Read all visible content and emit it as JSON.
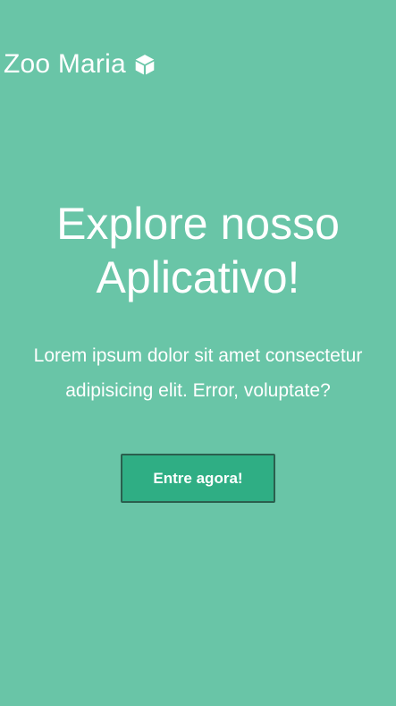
{
  "brand": {
    "name": "Zoo Maria",
    "icon": "cube-icon"
  },
  "hero": {
    "title": "Explore nosso Aplicativo!",
    "text": "Lorem ipsum dolor sit amet consectetur adipisicing elit. Error, voluptate?"
  },
  "cta": {
    "label": "Entre agora!"
  },
  "colors": {
    "background": "#69c5a7",
    "button": "#2fae84",
    "button_border": "#2b5f4e",
    "text": "#ffffff"
  }
}
